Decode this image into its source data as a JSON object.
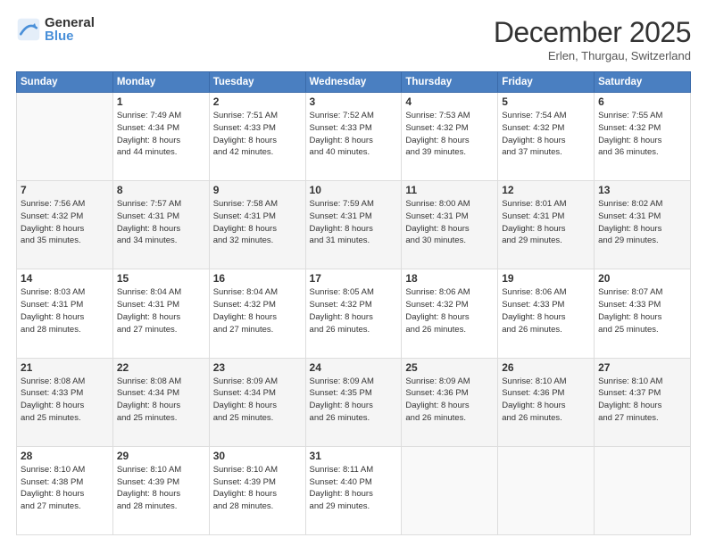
{
  "logo": {
    "general": "General",
    "blue": "Blue"
  },
  "title": {
    "month": "December 2025",
    "location": "Erlen, Thurgau, Switzerland"
  },
  "weekdays": [
    "Sunday",
    "Monday",
    "Tuesday",
    "Wednesday",
    "Thursday",
    "Friday",
    "Saturday"
  ],
  "weeks": [
    [
      {
        "day": "",
        "info": ""
      },
      {
        "day": "1",
        "info": "Sunrise: 7:49 AM\nSunset: 4:34 PM\nDaylight: 8 hours\nand 44 minutes."
      },
      {
        "day": "2",
        "info": "Sunrise: 7:51 AM\nSunset: 4:33 PM\nDaylight: 8 hours\nand 42 minutes."
      },
      {
        "day": "3",
        "info": "Sunrise: 7:52 AM\nSunset: 4:33 PM\nDaylight: 8 hours\nand 40 minutes."
      },
      {
        "day": "4",
        "info": "Sunrise: 7:53 AM\nSunset: 4:32 PM\nDaylight: 8 hours\nand 39 minutes."
      },
      {
        "day": "5",
        "info": "Sunrise: 7:54 AM\nSunset: 4:32 PM\nDaylight: 8 hours\nand 37 minutes."
      },
      {
        "day": "6",
        "info": "Sunrise: 7:55 AM\nSunset: 4:32 PM\nDaylight: 8 hours\nand 36 minutes."
      }
    ],
    [
      {
        "day": "7",
        "info": "Sunrise: 7:56 AM\nSunset: 4:32 PM\nDaylight: 8 hours\nand 35 minutes."
      },
      {
        "day": "8",
        "info": "Sunrise: 7:57 AM\nSunset: 4:31 PM\nDaylight: 8 hours\nand 34 minutes."
      },
      {
        "day": "9",
        "info": "Sunrise: 7:58 AM\nSunset: 4:31 PM\nDaylight: 8 hours\nand 32 minutes."
      },
      {
        "day": "10",
        "info": "Sunrise: 7:59 AM\nSunset: 4:31 PM\nDaylight: 8 hours\nand 31 minutes."
      },
      {
        "day": "11",
        "info": "Sunrise: 8:00 AM\nSunset: 4:31 PM\nDaylight: 8 hours\nand 30 minutes."
      },
      {
        "day": "12",
        "info": "Sunrise: 8:01 AM\nSunset: 4:31 PM\nDaylight: 8 hours\nand 29 minutes."
      },
      {
        "day": "13",
        "info": "Sunrise: 8:02 AM\nSunset: 4:31 PM\nDaylight: 8 hours\nand 29 minutes."
      }
    ],
    [
      {
        "day": "14",
        "info": "Sunrise: 8:03 AM\nSunset: 4:31 PM\nDaylight: 8 hours\nand 28 minutes."
      },
      {
        "day": "15",
        "info": "Sunrise: 8:04 AM\nSunset: 4:31 PM\nDaylight: 8 hours\nand 27 minutes."
      },
      {
        "day": "16",
        "info": "Sunrise: 8:04 AM\nSunset: 4:32 PM\nDaylight: 8 hours\nand 27 minutes."
      },
      {
        "day": "17",
        "info": "Sunrise: 8:05 AM\nSunset: 4:32 PM\nDaylight: 8 hours\nand 26 minutes."
      },
      {
        "day": "18",
        "info": "Sunrise: 8:06 AM\nSunset: 4:32 PM\nDaylight: 8 hours\nand 26 minutes."
      },
      {
        "day": "19",
        "info": "Sunrise: 8:06 AM\nSunset: 4:33 PM\nDaylight: 8 hours\nand 26 minutes."
      },
      {
        "day": "20",
        "info": "Sunrise: 8:07 AM\nSunset: 4:33 PM\nDaylight: 8 hours\nand 25 minutes."
      }
    ],
    [
      {
        "day": "21",
        "info": "Sunrise: 8:08 AM\nSunset: 4:33 PM\nDaylight: 8 hours\nand 25 minutes."
      },
      {
        "day": "22",
        "info": "Sunrise: 8:08 AM\nSunset: 4:34 PM\nDaylight: 8 hours\nand 25 minutes."
      },
      {
        "day": "23",
        "info": "Sunrise: 8:09 AM\nSunset: 4:34 PM\nDaylight: 8 hours\nand 25 minutes."
      },
      {
        "day": "24",
        "info": "Sunrise: 8:09 AM\nSunset: 4:35 PM\nDaylight: 8 hours\nand 26 minutes."
      },
      {
        "day": "25",
        "info": "Sunrise: 8:09 AM\nSunset: 4:36 PM\nDaylight: 8 hours\nand 26 minutes."
      },
      {
        "day": "26",
        "info": "Sunrise: 8:10 AM\nSunset: 4:36 PM\nDaylight: 8 hours\nand 26 minutes."
      },
      {
        "day": "27",
        "info": "Sunrise: 8:10 AM\nSunset: 4:37 PM\nDaylight: 8 hours\nand 27 minutes."
      }
    ],
    [
      {
        "day": "28",
        "info": "Sunrise: 8:10 AM\nSunset: 4:38 PM\nDaylight: 8 hours\nand 27 minutes."
      },
      {
        "day": "29",
        "info": "Sunrise: 8:10 AM\nSunset: 4:39 PM\nDaylight: 8 hours\nand 28 minutes."
      },
      {
        "day": "30",
        "info": "Sunrise: 8:10 AM\nSunset: 4:39 PM\nDaylight: 8 hours\nand 28 minutes."
      },
      {
        "day": "31",
        "info": "Sunrise: 8:11 AM\nSunset: 4:40 PM\nDaylight: 8 hours\nand 29 minutes."
      },
      {
        "day": "",
        "info": ""
      },
      {
        "day": "",
        "info": ""
      },
      {
        "day": "",
        "info": ""
      }
    ]
  ]
}
